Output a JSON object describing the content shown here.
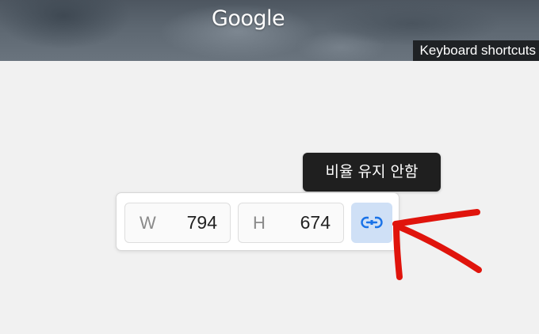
{
  "map": {
    "logo_text": "Google",
    "keyboard_shortcuts_label": "Keyboard shortcuts"
  },
  "tooltip": {
    "text": "비율 유지 안함"
  },
  "dimensions": {
    "width_label": "W",
    "width_value": "794",
    "height_label": "H",
    "height_value": "674",
    "aspect_link_icon": "link-icon",
    "aspect_link_active": true
  },
  "colors": {
    "link_button_bg": "#cfe0f6",
    "link_icon": "#1a73e8",
    "annotation_arrow": "#e0140c",
    "tooltip_bg": "#1f1f1f"
  }
}
